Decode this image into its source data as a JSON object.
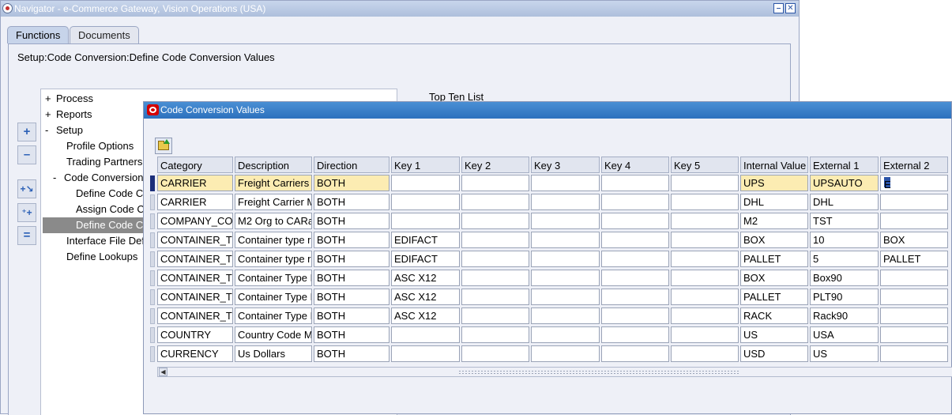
{
  "navigator": {
    "title": "Navigator - e-Commerce Gateway, Vision Operations (USA)",
    "tabs": [
      {
        "label": "Functions",
        "active": true
      },
      {
        "label": "Documents",
        "active": false
      }
    ],
    "breadcrumb": "Setup:Code Conversion:Define Code Conversion Values",
    "top_ten_label": "Top Ten List",
    "tree": [
      {
        "expander": "+",
        "label": "Process"
      },
      {
        "expander": "+",
        "label": "Reports"
      },
      {
        "expander": "-",
        "label": "Setup"
      },
      {
        "expander": "",
        "label": "Profile Options"
      },
      {
        "expander": "",
        "label": "Trading Partners"
      },
      {
        "expander": "-",
        "label": "Code Conversion"
      },
      {
        "expander": "",
        "label": "Define Code Co"
      },
      {
        "expander": "",
        "label": "Assign Code Co"
      },
      {
        "expander": "",
        "label": "Define Code Co",
        "selected": true
      },
      {
        "expander": "",
        "label": "Interface File Def"
      },
      {
        "expander": "",
        "label": "Define Lookups"
      }
    ],
    "side_buttons": [
      "add-icon",
      "remove-icon",
      "move-right-icon",
      "add-all-icon",
      "remove-all-icon"
    ]
  },
  "ccv": {
    "title": "Code Conversion Values",
    "columns": [
      "Category",
      "Description",
      "Direction",
      "Key 1",
      "Key 2",
      "Key 3",
      "Key 4",
      "Key 5",
      "Internal Value",
      "External 1",
      "External 2"
    ],
    "rows": [
      [
        "CARRIER",
        "Freight Carriers",
        "BOTH",
        "",
        "",
        "",
        "",
        "",
        "UPS",
        "UPSAUTO",
        "E"
      ],
      [
        "CARRIER",
        "Freight Carrier M",
        "BOTH",
        "",
        "",
        "",
        "",
        "",
        "DHL",
        "DHL",
        ""
      ],
      [
        "COMPANY_CO",
        "M2 Org to CARa",
        "BOTH",
        "",
        "",
        "",
        "",
        "",
        "M2",
        "TST",
        ""
      ],
      [
        "CONTAINER_TY",
        "Container type r",
        "BOTH",
        "EDIFACT",
        "",
        "",
        "",
        "",
        "BOX",
        "10",
        "BOX"
      ],
      [
        "CONTAINER_TY",
        "Container type r",
        "BOTH",
        "EDIFACT",
        "",
        "",
        "",
        "",
        "PALLET",
        "5",
        "PALLET"
      ],
      [
        "CONTAINER_TY",
        "Container Type I",
        "BOTH",
        "ASC X12",
        "",
        "",
        "",
        "",
        "BOX",
        "Box90",
        ""
      ],
      [
        "CONTAINER_TY",
        "Container Type I",
        "BOTH",
        "ASC X12",
        "",
        "",
        "",
        "",
        "PALLET",
        "PLT90",
        ""
      ],
      [
        "CONTAINER_TY",
        "Container Type I",
        "BOTH",
        "ASC X12",
        "",
        "",
        "",
        "",
        "RACK",
        "Rack90",
        ""
      ],
      [
        "COUNTRY",
        "Country Code M",
        "BOTH",
        "",
        "",
        "",
        "",
        "",
        "US",
        "USA",
        ""
      ],
      [
        "CURRENCY",
        "Us Dollars",
        "BOTH",
        "",
        "",
        "",
        "",
        "",
        "USD",
        "US",
        ""
      ]
    ],
    "current_row": 0
  },
  "colors": {
    "current_row_highlight": "#fcecb2",
    "titlebar_active": "#2d71bd",
    "selected_tree_item": "#8a8a8a"
  }
}
